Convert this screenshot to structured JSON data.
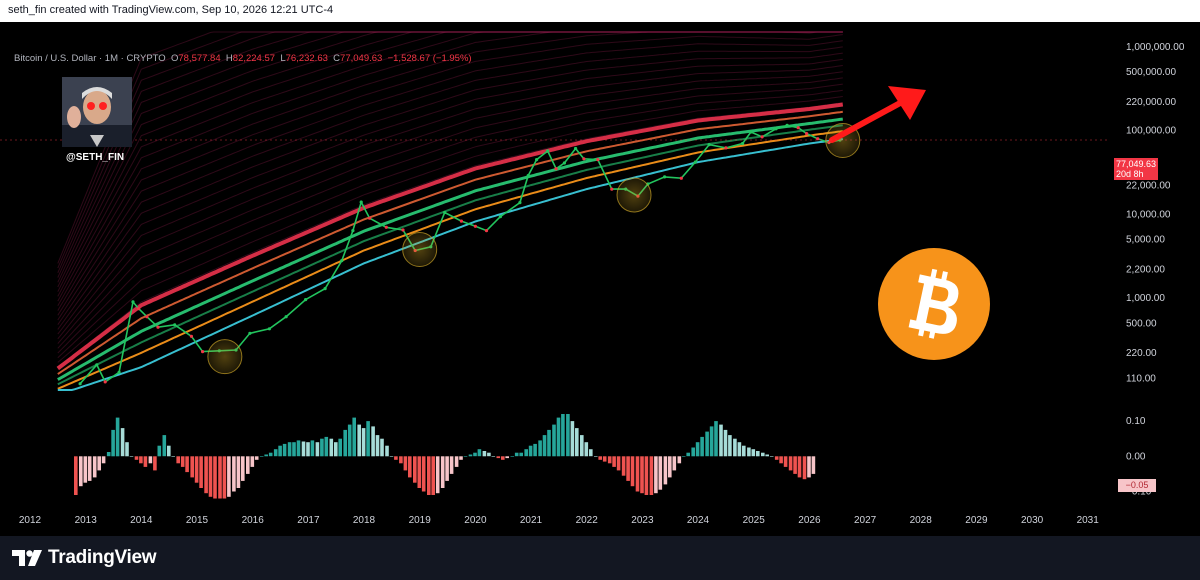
{
  "header": {
    "credit": "seth_fin created with TradingView.com, Sep 10, 2026 12:21 UTC-4"
  },
  "legend": {
    "symbol": "Bitcoin / U.S. Dollar · 1M · CRYPTO",
    "o_label": "O",
    "o_value": "78,577.84",
    "h_label": "H",
    "h_value": "82,224.57",
    "l_label": "L",
    "l_value": "76,232.63",
    "c_label": "C",
    "c_value": "77,049.63",
    "change": "−1,528.67 (−1.95%)"
  },
  "avatar": {
    "handle": "@SETH_FIN"
  },
  "price_tag": {
    "price": "77,049.63",
    "countdown": "20d 8h"
  },
  "osc_tag": {
    "value": "−0.05"
  },
  "footer": {
    "brand": "TradingView"
  },
  "colors": {
    "up": "#22c55e",
    "down": "#f23645",
    "rainbow_red": "#e0304a",
    "orange": "#f7931a",
    "cyan": "#3bc9db",
    "osc_up": "#26a69a",
    "osc_down": "#ef5350"
  },
  "icons": {
    "logo": "bitcoin-logo-icon",
    "arrow": "red-arrow-icon",
    "brand": "tradingview-logo-icon"
  },
  "chart_data": [
    {
      "type": "candlestick",
      "title": "Bitcoin / U.S. Dollar · 1M · CRYPTO",
      "y_scale": "log",
      "ylim": [
        80,
        1500000
      ],
      "xlim": [
        2012.0,
        2031.4
      ],
      "y_ticks": [
        110,
        220,
        500,
        1000,
        2200,
        5000,
        10000,
        22000,
        100000,
        220000,
        500000,
        1000000
      ],
      "y_tick_labels": [
        "110.00",
        "220.00",
        "500.00",
        "1,000.00",
        "2,200.00",
        "5,000.00",
        "10,000.00",
        "22,000.00",
        "100,000.00",
        "220,000.00",
        "500,000.00",
        "1,000,000.00"
      ],
      "x_ticks": [
        2012,
        2013,
        2014,
        2015,
        2016,
        2017,
        2018,
        2019,
        2020,
        2021,
        2022,
        2023,
        2024,
        2025,
        2026,
        2027,
        2028,
        2029,
        2030,
        2031
      ],
      "x_tick_labels": [
        "2012",
        "2013",
        "2014",
        "2015",
        "2016",
        "2017",
        "2018",
        "2019",
        "2020",
        "2021",
        "2022",
        "2023",
        "2024",
        "2025",
        "2026",
        "2027",
        "2028",
        "2029",
        "2030",
        "2031"
      ],
      "last_price": 77049.63,
      "price_path": [
        [
          2012.9,
          95
        ],
        [
          2013.2,
          160
        ],
        [
          2013.35,
          100
        ],
        [
          2013.6,
          130
        ],
        [
          2013.85,
          900
        ],
        [
          2013.95,
          750
        ],
        [
          2014.1,
          600
        ],
        [
          2014.3,
          450
        ],
        [
          2014.6,
          480
        ],
        [
          2014.9,
          350
        ],
        [
          2015.1,
          230
        ],
        [
          2015.4,
          235
        ],
        [
          2015.7,
          240
        ],
        [
          2015.95,
          380
        ],
        [
          2016.3,
          430
        ],
        [
          2016.6,
          600
        ],
        [
          2016.95,
          960
        ],
        [
          2017.3,
          1300
        ],
        [
          2017.6,
          2800
        ],
        [
          2017.8,
          6400
        ],
        [
          2017.95,
          14000
        ],
        [
          2018.1,
          9000
        ],
        [
          2018.4,
          7000
        ],
        [
          2018.7,
          6500
        ],
        [
          2018.92,
          3700
        ],
        [
          2019.2,
          4100
        ],
        [
          2019.45,
          10500
        ],
        [
          2019.75,
          8300
        ],
        [
          2020.0,
          7200
        ],
        [
          2020.2,
          6400
        ],
        [
          2020.45,
          9400
        ],
        [
          2020.8,
          13800
        ],
        [
          2020.95,
          29000
        ],
        [
          2021.1,
          45000
        ],
        [
          2021.3,
          57000
        ],
        [
          2021.45,
          35000
        ],
        [
          2021.6,
          41000
        ],
        [
          2021.8,
          61000
        ],
        [
          2021.95,
          46000
        ],
        [
          2022.2,
          45000
        ],
        [
          2022.45,
          20000
        ],
        [
          2022.7,
          20000
        ],
        [
          2022.92,
          16500
        ],
        [
          2023.1,
          23000
        ],
        [
          2023.4,
          28000
        ],
        [
          2023.7,
          27000
        ],
        [
          2023.95,
          42000
        ],
        [
          2024.2,
          68000
        ],
        [
          2024.5,
          62000
        ],
        [
          2024.8,
          70000
        ],
        [
          2024.95,
          96000
        ],
        [
          2025.15,
          84000
        ],
        [
          2025.4,
          105000
        ],
        [
          2025.6,
          115000
        ],
        [
          2025.8,
          108000
        ],
        [
          2025.95,
          92000
        ],
        [
          2026.15,
          80000
        ],
        [
          2026.35,
          72000
        ],
        [
          2026.55,
          77049.63
        ]
      ],
      "lower_band": [
        [
          2012.5,
          70
        ],
        [
          2014,
          150
        ],
        [
          2016,
          620
        ],
        [
          2018,
          2600
        ],
        [
          2020,
          8200
        ],
        [
          2022,
          20000
        ],
        [
          2024,
          42000
        ],
        [
          2026,
          70000
        ],
        [
          2026.6,
          79000
        ]
      ],
      "upper_band": [
        [
          2012.5,
          150
        ],
        [
          2014,
          900
        ],
        [
          2016,
          3500
        ],
        [
          2018,
          13000
        ],
        [
          2020,
          38000
        ],
        [
          2022,
          80000
        ],
        [
          2024,
          140000
        ],
        [
          2026,
          190000
        ],
        [
          2026.6,
          215000
        ]
      ],
      "highlighted_lows": [
        [
          2015.5,
          200
        ],
        [
          2019.0,
          3800
        ],
        [
          2022.85,
          17000
        ],
        [
          2026.6,
          76000
        ]
      ]
    },
    {
      "type": "bar",
      "title": "",
      "ylim": [
        -0.13,
        0.14
      ],
      "y_ticks": [
        0.1,
        0.0,
        -0.1
      ],
      "y_tick_labels": [
        "0.10",
        "0.00",
        "−0.10"
      ],
      "x": [
        2012.83,
        2012.92,
        2013.0,
        2013.08,
        2013.17,
        2013.25,
        2013.33,
        2013.42,
        2013.5,
        2013.58,
        2013.67,
        2013.75,
        2013.83,
        2013.92,
        2014.0,
        2014.08,
        2014.17,
        2014.25,
        2014.33,
        2014.42,
        2014.5,
        2014.58,
        2014.67,
        2014.75,
        2014.83,
        2014.92,
        2015.0,
        2015.08,
        2015.17,
        2015.25,
        2015.33,
        2015.42,
        2015.5,
        2015.58,
        2015.67,
        2015.75,
        2015.83,
        2015.92,
        2016.0,
        2016.08,
        2016.17,
        2016.25,
        2016.33,
        2016.42,
        2016.5,
        2016.58,
        2016.67,
        2016.75,
        2016.83,
        2016.92,
        2017.0,
        2017.08,
        2017.17,
        2017.25,
        2017.33,
        2017.42,
        2017.5,
        2017.58,
        2017.67,
        2017.75,
        2017.83,
        2017.92,
        2018.0,
        2018.08,
        2018.17,
        2018.25,
        2018.33,
        2018.42,
        2018.5,
        2018.58,
        2018.67,
        2018.75,
        2018.83,
        2018.92,
        2019.0,
        2019.08,
        2019.17,
        2019.25,
        2019.33,
        2019.42,
        2019.5,
        2019.58,
        2019.67,
        2019.75,
        2019.83,
        2019.92,
        2020.0,
        2020.08,
        2020.17,
        2020.25,
        2020.33,
        2020.42,
        2020.5,
        2020.58,
        2020.67,
        2020.75,
        2020.83,
        2020.92,
        2021.0,
        2021.08,
        2021.17,
        2021.25,
        2021.33,
        2021.42,
        2021.5,
        2021.58,
        2021.67,
        2021.75,
        2021.83,
        2021.92,
        2022.0,
        2022.08,
        2022.17,
        2022.25,
        2022.33,
        2022.42,
        2022.5,
        2022.58,
        2022.67,
        2022.75,
        2022.83,
        2022.92,
        2023.0,
        2023.08,
        2023.17,
        2023.25,
        2023.33,
        2023.42,
        2023.5,
        2023.58,
        2023.67,
        2023.75,
        2023.83,
        2023.92,
        2024.0,
        2024.08,
        2024.17,
        2024.25,
        2024.33,
        2024.42,
        2024.5,
        2024.58,
        2024.67,
        2024.75,
        2024.83,
        2024.92,
        2025.0,
        2025.08,
        2025.17,
        2025.25,
        2025.33,
        2025.42,
        2025.5,
        2025.58,
        2025.67,
        2025.75,
        2025.83,
        2025.92,
        2026.0,
        2026.08,
        2026.17,
        2026.25,
        2026.33,
        2026.42,
        2026.5,
        2026.58
      ],
      "values": [
        -0.11,
        -0.085,
        -0.075,
        -0.07,
        -0.06,
        -0.04,
        -0.02,
        0.012,
        0.075,
        0.11,
        0.08,
        0.04,
        0.0,
        -0.01,
        -0.02,
        -0.03,
        -0.02,
        -0.04,
        0.03,
        0.06,
        0.03,
        0.0,
        -0.02,
        -0.03,
        -0.045,
        -0.06,
        -0.075,
        -0.09,
        -0.105,
        -0.115,
        -0.12,
        -0.12,
        -0.12,
        -0.115,
        -0.1,
        -0.09,
        -0.07,
        -0.05,
        -0.03,
        -0.01,
        0.0,
        0.005,
        0.01,
        0.02,
        0.03,
        0.035,
        0.04,
        0.04,
        0.045,
        0.042,
        0.04,
        0.045,
        0.04,
        0.05,
        0.055,
        0.05,
        0.04,
        0.05,
        0.075,
        0.09,
        0.11,
        0.09,
        0.08,
        0.1,
        0.085,
        0.06,
        0.05,
        0.03,
        0.0,
        -0.01,
        -0.02,
        -0.04,
        -0.06,
        -0.075,
        -0.09,
        -0.1,
        -0.11,
        -0.11,
        -0.105,
        -0.09,
        -0.07,
        -0.05,
        -0.03,
        -0.01,
        0.0,
        0.005,
        0.01,
        0.02,
        0.015,
        0.01,
        0.0,
        -0.005,
        -0.01,
        -0.005,
        0.0,
        0.01,
        0.01,
        0.02,
        0.03,
        0.035,
        0.045,
        0.06,
        0.075,
        0.09,
        0.11,
        0.12,
        0.12,
        0.1,
        0.08,
        0.06,
        0.04,
        0.02,
        0.0,
        -0.01,
        -0.015,
        -0.02,
        -0.03,
        -0.04,
        -0.055,
        -0.07,
        -0.085,
        -0.1,
        -0.105,
        -0.11,
        -0.11,
        -0.105,
        -0.095,
        -0.08,
        -0.06,
        -0.04,
        -0.02,
        0.0,
        0.01,
        0.025,
        0.04,
        0.055,
        0.07,
        0.085,
        0.1,
        0.09,
        0.075,
        0.06,
        0.05,
        0.04,
        0.03,
        0.025,
        0.02,
        0.015,
        0.01,
        0.005,
        0.0,
        -0.01,
        -0.02,
        -0.03,
        -0.04,
        -0.05,
        -0.06,
        -0.065,
        -0.06,
        -0.05
      ]
    }
  ]
}
